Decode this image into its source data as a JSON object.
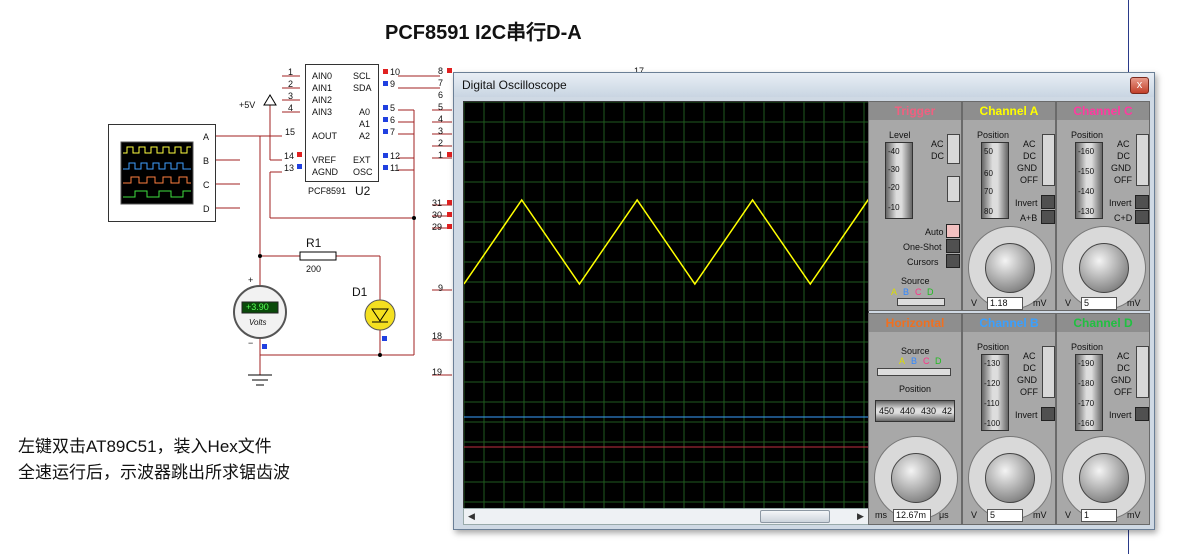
{
  "page_title": "PCF8591  I2C串行D-A",
  "instructions": [
    "左键双击AT89C51，装入Hex文件",
    "全速运行后，示波器跳出所求锯齿波"
  ],
  "schematic": {
    "chip_name": "PCF8591",
    "chip_ref": "U2",
    "chip_left_pins": [
      {
        "num": "1",
        "name": "AIN0"
      },
      {
        "num": "2",
        "name": "AIN1"
      },
      {
        "num": "3",
        "name": "AIN2"
      },
      {
        "num": "4",
        "name": "AIN3"
      },
      {
        "num": "15",
        "name": "AOUT"
      },
      {
        "num": "14",
        "name": "VREF"
      },
      {
        "num": "13",
        "name": "AGND"
      }
    ],
    "chip_right_pins": [
      {
        "num": "10",
        "name": "SCL"
      },
      {
        "num": "9",
        "name": "SDA"
      },
      {
        "num": "5",
        "name": "A0"
      },
      {
        "num": "6",
        "name": "A1"
      },
      {
        "num": "7",
        "name": "A2"
      },
      {
        "num": "12",
        "name": "EXT"
      },
      {
        "num": "11",
        "name": "OSC"
      }
    ],
    "vcc_label": "+5V",
    "resistor_ref": "R1",
    "resistor_value": "200",
    "diode_ref": "D1",
    "voltmeter_value": "+3.90",
    "voltmeter_unit": "Volts",
    "scope_channels": [
      "A",
      "B",
      "C",
      "D"
    ],
    "edge_pins": [
      "8",
      "7",
      "6",
      "5",
      "4",
      "3",
      "2",
      "1",
      "31",
      "30",
      "29",
      "9",
      "18",
      "19",
      "17"
    ],
    "polarity_plus": "+",
    "polarity_minus": "−"
  },
  "oscilloscope": {
    "window_title": "Digital Oscilloscope",
    "close_glyph": "x",
    "trigger": {
      "title": "Trigger",
      "level_label": "Level",
      "ac": "AC",
      "dc": "DC",
      "scale": [
        "-40",
        "-30",
        "-20",
        "-10"
      ],
      "auto": "Auto",
      "one_shot": "One-Shot",
      "cursors": "Cursors",
      "source_label": "Source",
      "sources": [
        "A",
        "B",
        "C",
        "D"
      ]
    },
    "channel_a": {
      "title": "Channel A",
      "position_label": "Position",
      "scale": [
        "50",
        "60",
        "70",
        "80"
      ],
      "coupling": [
        "AC",
        "DC",
        "GND",
        "OFF"
      ],
      "invert": "Invert",
      "extra": "A+B",
      "dial_ticks": [
        "0.5",
        "0.2",
        "0.1",
        "50",
        "20",
        "10",
        "5",
        "2",
        "1",
        "20",
        "10",
        "5",
        "2"
      ],
      "unit_left": "V",
      "unit_right": "mV",
      "value": "1.18"
    },
    "channel_c": {
      "title": "Channel C",
      "position_label": "Position",
      "scale": [
        "-160",
        "-150",
        "-140",
        "-130"
      ],
      "coupling": [
        "AC",
        "DC",
        "GND",
        "OFF"
      ],
      "invert": "Invert",
      "extra": "C+D",
      "dial_ticks": [
        "0.5",
        "0.2",
        "0.1",
        "50",
        "20",
        "10",
        "5",
        "2",
        "1",
        "20",
        "10",
        "5",
        "2"
      ],
      "unit_left": "V",
      "unit_right": "mV",
      "value": "5"
    },
    "horizontal": {
      "title": "Horizontal",
      "source_label": "Source",
      "sources": [
        "A",
        "B",
        "C",
        "D"
      ],
      "position_label": "Position",
      "position_scale": [
        "450",
        "440",
        "430",
        "42"
      ],
      "dial_ticks": [
        "0.5",
        "0.2",
        "0.1",
        "50",
        "20",
        "10",
        "5",
        "2",
        "1",
        "200",
        "100",
        "50",
        "20",
        "10"
      ],
      "unit_left": "ms",
      "unit_right": "μs",
      "value": "12.67m"
    },
    "channel_b": {
      "title": "Channel B",
      "position_label": "Position",
      "scale": [
        "-130",
        "-120",
        "-110",
        "-100"
      ],
      "coupling": [
        "AC",
        "DC",
        "GND",
        "OFF"
      ],
      "invert": "Invert",
      "dial_ticks": [
        "0.5",
        "0.2",
        "0.1",
        "50",
        "20",
        "10",
        "5",
        "2",
        "1",
        "20",
        "10",
        "5",
        "2"
      ],
      "unit_left": "V",
      "unit_right": "mV",
      "value": "5"
    },
    "channel_d": {
      "title": "Channel D",
      "position_label": "Position",
      "scale": [
        "-190",
        "-180",
        "-170",
        "-160"
      ],
      "coupling": [
        "AC",
        "DC",
        "GND",
        "OFF"
      ],
      "invert": "Invert",
      "dial_ticks": [
        "0.5",
        "0.2",
        "0.1",
        "50",
        "20",
        "10",
        "5",
        "2",
        "1",
        "20",
        "10",
        "5",
        "2"
      ],
      "unit_left": "V",
      "unit_right": "mV",
      "value": "1"
    },
    "colors": {
      "channel_a": "#ffff00",
      "channel_b": "#3aa0ff",
      "channel_c": "#ff3aa0",
      "channel_d": "#20c040",
      "trigger": "#f06080",
      "horizontal": "#f07020",
      "grid": "#1f5a1f",
      "screen": "#000000"
    },
    "waveform": {
      "shape": "triangle",
      "periods": 3.5,
      "trace": "channel_a"
    }
  }
}
